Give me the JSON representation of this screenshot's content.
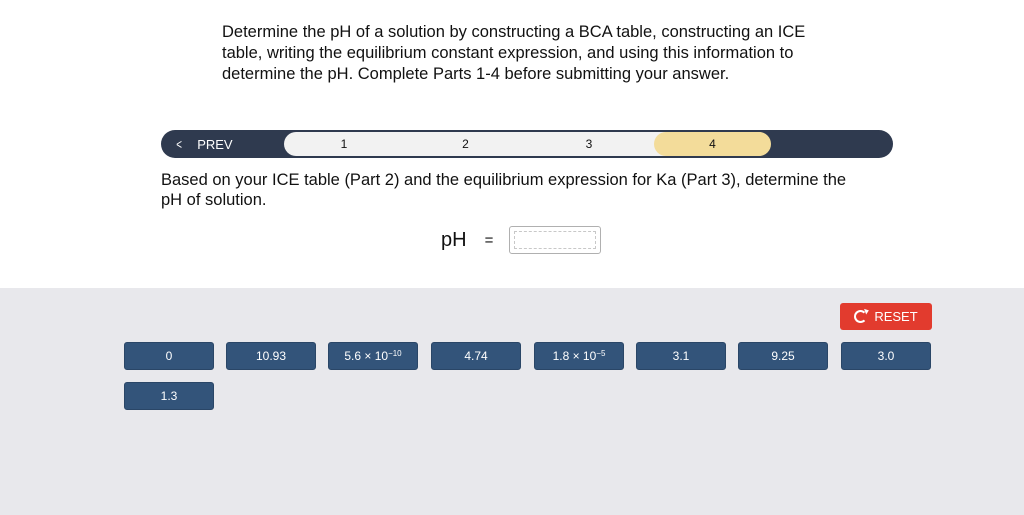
{
  "instructions": "Determine the pH of a solution by constructing a BCA table, constructing an ICE table, writing the equilibrium constant expression, and using this information to determine the pH. Complete Parts 1-4 before submitting your answer.",
  "nav": {
    "prev_label": "PREV",
    "steps": [
      "1",
      "2",
      "3",
      "4"
    ],
    "active_step": "4"
  },
  "question": "Based on your ICE table (Part 2) and the equilibrium expression for Ka (Part 3), determine the pH of solution.",
  "answer": {
    "label": "pH",
    "equals": "=",
    "value": ""
  },
  "reset_label": "RESET",
  "tiles": [
    {
      "base": "0"
    },
    {
      "base": "10.93"
    },
    {
      "base": "5.6 × 10",
      "exp": "−10"
    },
    {
      "base": "4.74"
    },
    {
      "base": "1.8 × 10",
      "exp": "−5"
    },
    {
      "base": "3.1"
    },
    {
      "base": "9.25"
    },
    {
      "base": "3.0"
    },
    {
      "base": "1.3"
    }
  ],
  "colors": {
    "nav_bar": "#2f3a4f",
    "active_step": "#f3dc9a",
    "tile": "#33547a",
    "reset": "#e23b2e",
    "tray": "#e8e8ec"
  }
}
